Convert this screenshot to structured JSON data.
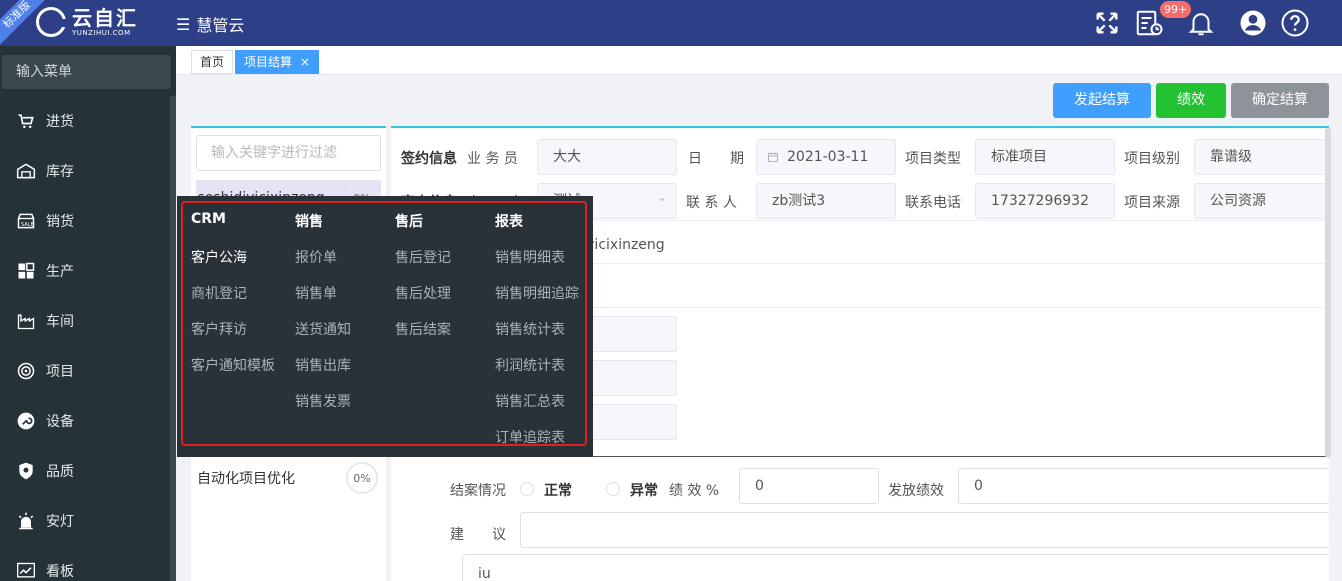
{
  "header": {
    "edition_ribbon": "标准版",
    "logo_text": "云自汇",
    "logo_subtext": "YUNZIHUI.COM",
    "app_name": "慧管云",
    "notification_badge": "99+"
  },
  "sidebar": {
    "search_placeholder": "输入菜单",
    "items": [
      {
        "label": "进货",
        "icon": "cart-icon"
      },
      {
        "label": "库存",
        "icon": "warehouse-icon"
      },
      {
        "label": "销货",
        "icon": "store-icon"
      },
      {
        "label": "生产",
        "icon": "grid-icon"
      },
      {
        "label": "车间",
        "icon": "factory-icon"
      },
      {
        "label": "项目",
        "icon": "target-icon"
      },
      {
        "label": "设备",
        "icon": "wrench-icon"
      },
      {
        "label": "品质",
        "icon": "shield-icon"
      },
      {
        "label": "安灯",
        "icon": "alarm-light-icon"
      },
      {
        "label": "看板",
        "icon": "chart-board-icon"
      }
    ]
  },
  "tabs": {
    "home": "首页",
    "current": "项目结算",
    "close": "×"
  },
  "actions": {
    "start_settlement": "发起结算",
    "performance": "绩效",
    "confirm_settlement": "确定结算",
    "colors": {
      "blue": "#409eff",
      "green": "#22c232",
      "gray": "#8d9399"
    }
  },
  "project_list": {
    "filter_placeholder": "输入关键字进行过滤",
    "items": [
      {
        "name": "ceshidiyicixinzeng",
        "progress": "0%"
      },
      {
        "name": "自动化项目优化",
        "progress": "0%"
      }
    ]
  },
  "form": {
    "section_sign": "签约信息",
    "section_customer": "客户信息",
    "salesperson_label": "业 务 员",
    "salesperson_value": "大大",
    "date_label": "日　　期",
    "date_value": "2021-03-11",
    "project_type_label": "项目类型",
    "project_type_value": "标准项目",
    "project_level_label": "项目级别",
    "project_level_value": "靠谱级",
    "customer_label": "客　　户",
    "customer_value": "测试",
    "contact_label": "联 系 人",
    "contact_value": "zb测试3",
    "phone_label": "联系电话",
    "phone_value": "17327296932",
    "source_label": "项目来源",
    "source_value": "公司资源",
    "project_name_value": "ceshidiyicixinzeng",
    "case_status_label": "结案情况",
    "status_normal": "正常",
    "status_abnormal": "异常",
    "perf_pct_label": "绩 效 %",
    "perf_pct_value": "0",
    "issue_perf_label": "发放绩效",
    "issue_perf_value": "0",
    "suggestion_label": "建　　议",
    "note_value": "iu"
  },
  "mega_menu": {
    "columns": [
      {
        "title": "CRM",
        "items": [
          "客户公海",
          "商机登记",
          "客户拜访",
          "客户通知模板"
        ]
      },
      {
        "title": "销售",
        "items": [
          "报价单",
          "销售单",
          "送货通知",
          "销售出库",
          "销售发票"
        ]
      },
      {
        "title": "售后",
        "items": [
          "售后登记",
          "售后处理",
          "售后结案"
        ]
      },
      {
        "title": "报表",
        "items": [
          "销售明细表",
          "销售明细追踪",
          "销售统计表",
          "利润统计表",
          "销售汇总表",
          "订单追踪表"
        ]
      }
    ]
  }
}
